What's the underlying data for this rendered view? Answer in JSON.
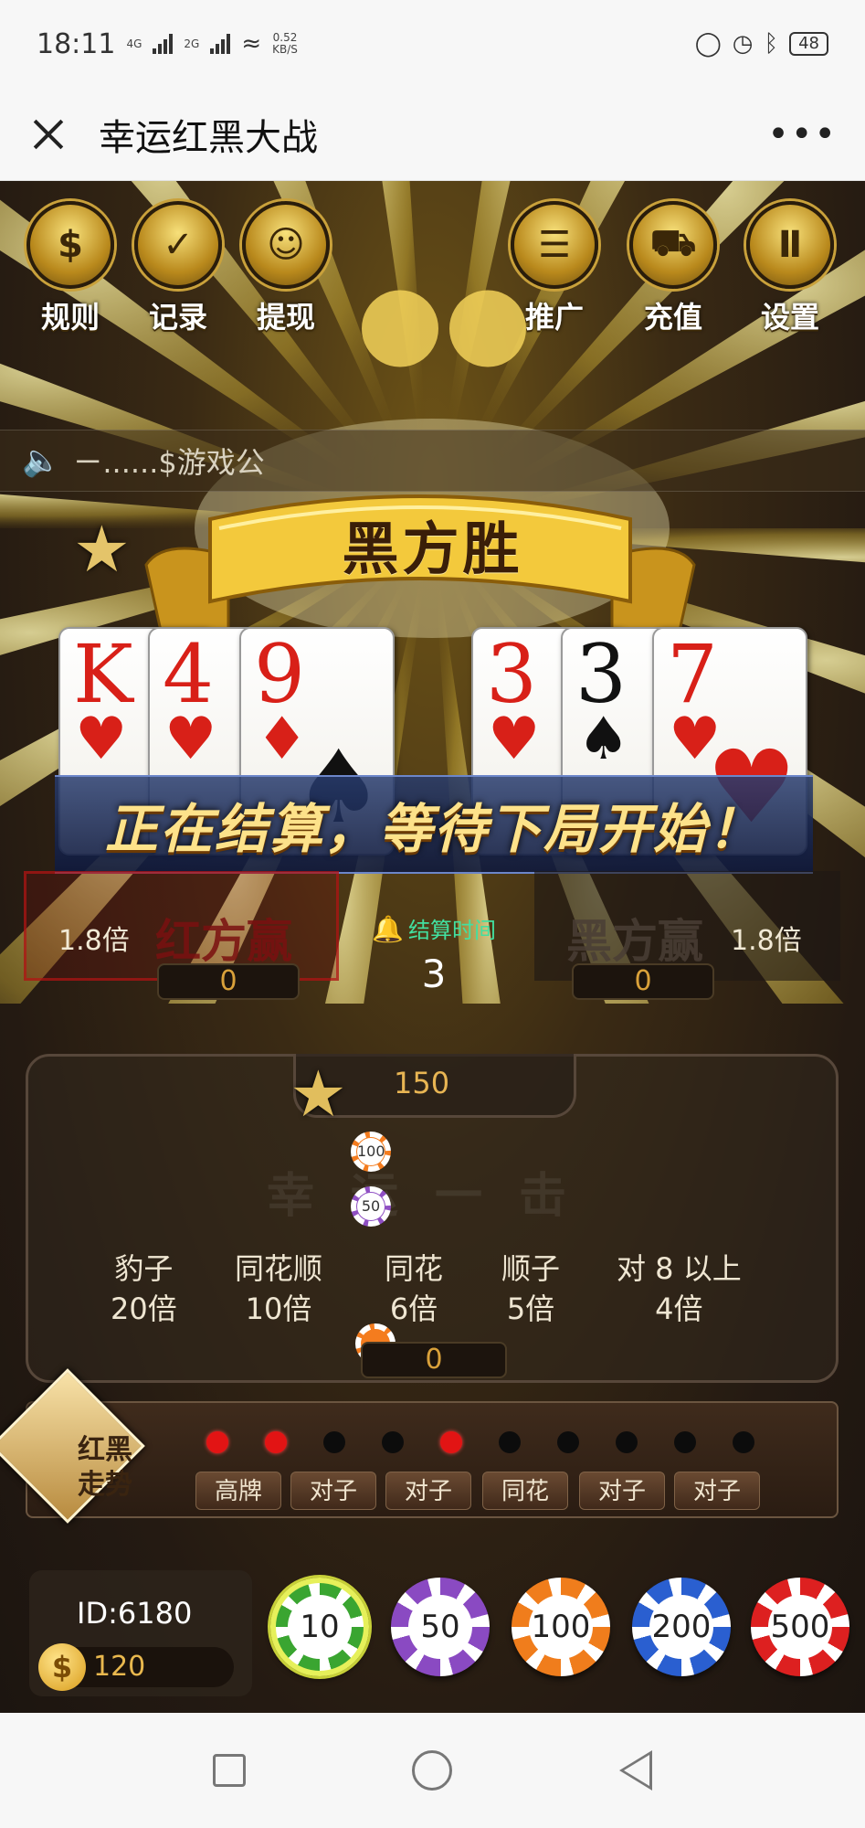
{
  "status": {
    "time": "18:11",
    "net1": "4G",
    "net2": "2G",
    "speed_value": "0.52",
    "speed_unit": "KB/S",
    "battery": "48"
  },
  "titlebar": {
    "title": "幸运红黑大战",
    "more": "•••"
  },
  "menu": {
    "left": [
      {
        "label": "规则",
        "icon": "rules-icon",
        "glyph": "$"
      },
      {
        "label": "记录",
        "icon": "record-icon",
        "glyph": "✓"
      },
      {
        "label": "提现",
        "icon": "withdraw-icon",
        "glyph": "☺"
      }
    ],
    "right": [
      {
        "label": "推广",
        "icon": "promote-icon",
        "glyph": "☰"
      },
      {
        "label": "充值",
        "icon": "cart-icon",
        "glyph": "⛟"
      },
      {
        "label": "设置",
        "icon": "podium-icon",
        "glyph": "Ⅱ"
      }
    ]
  },
  "marquee": {
    "text": "ㄧ......$游戏公"
  },
  "result": {
    "title": "黑方胜",
    "status": "正在结算，等待下局开始！"
  },
  "cards": {
    "red": [
      {
        "rank": "K",
        "suit": "♥",
        "color": "red"
      },
      {
        "rank": "4",
        "suit": "♥",
        "color": "red"
      },
      {
        "rank": "9",
        "suit": "♦",
        "color": "red"
      }
    ],
    "black": [
      {
        "rank": "3",
        "suit": "♥",
        "color": "red"
      },
      {
        "rank": "3",
        "suit": "♠",
        "color": "black"
      },
      {
        "rank": "7",
        "suit": "♥",
        "color": "red"
      }
    ]
  },
  "bets": {
    "red": {
      "label": "红方赢",
      "multiplier": "1.8倍",
      "amount": "0"
    },
    "black": {
      "label": "黑方赢",
      "multiplier": "1.8倍",
      "amount": "0"
    }
  },
  "timer": {
    "label": "结算时间",
    "value": "3"
  },
  "special": {
    "pool": "150",
    "watermark": "幸运一击",
    "chips": [
      "100",
      "50"
    ],
    "patterns": [
      {
        "name": "豹子",
        "mult": "20倍"
      },
      {
        "name": "同花顺",
        "mult": "10倍"
      },
      {
        "name": "同花",
        "mult": "6倍"
      },
      {
        "name": "顺子",
        "mult": "5倍"
      },
      {
        "name": "对 8 以上",
        "mult": "4倍"
      }
    ],
    "amount": "0"
  },
  "trend": {
    "title_line1": "红黑",
    "title_line2": "走势",
    "dots": [
      "red",
      "red",
      "black",
      "black",
      "red",
      "black",
      "black",
      "black",
      "black",
      "black"
    ],
    "tags": [
      "高牌",
      "对子",
      "对子",
      "同花",
      "对子",
      "对子"
    ]
  },
  "account": {
    "id": "ID:6180",
    "balance": "120",
    "coin": "$"
  },
  "chips": [
    {
      "value": "10",
      "color": "green"
    },
    {
      "value": "50",
      "color": "purple"
    },
    {
      "value": "100",
      "color": "orange"
    },
    {
      "value": "200",
      "color": "blue"
    },
    {
      "value": "500",
      "color": "red"
    }
  ],
  "colors": {
    "accent_gold": "#d9a13a",
    "timer_green": "#42e0a0",
    "red_dot": "#e21414"
  }
}
